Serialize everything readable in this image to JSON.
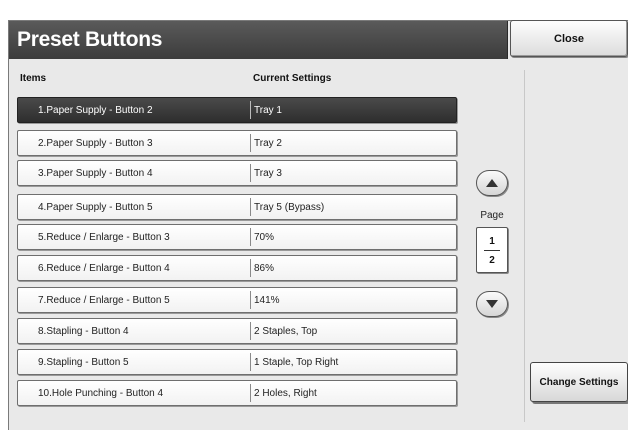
{
  "window": {
    "title": "Preset Buttons",
    "close_label": "Close"
  },
  "columns": {
    "items": "Items",
    "current_settings": "Current Settings"
  },
  "rows": [
    {
      "item": "1.Paper Supply - Button 2",
      "setting": "Tray 1",
      "selected": true
    },
    {
      "item": "2.Paper Supply - Button 3",
      "setting": "Tray 2",
      "selected": false
    },
    {
      "item": "3.Paper Supply - Button 4",
      "setting": "Tray 3",
      "selected": false
    },
    {
      "item": "4.Paper Supply - Button 5",
      "setting": "Tray 5 (Bypass)",
      "selected": false
    },
    {
      "item": "5.Reduce / Enlarge - Button 3",
      "setting": "70%",
      "selected": false
    },
    {
      "item": "6.Reduce / Enlarge - Button 4",
      "setting": "86%",
      "selected": false
    },
    {
      "item": "7.Reduce / Enlarge - Button 5",
      "setting": "141%",
      "selected": false
    },
    {
      "item": "8.Stapling - Button 4",
      "setting": "2 Staples, Top",
      "selected": false
    },
    {
      "item": "9.Stapling - Button 5",
      "setting": "1 Staple, Top Right",
      "selected": false
    },
    {
      "item": "10.Hole Punching - Button 4",
      "setting": "2 Holes, Right",
      "selected": false
    }
  ],
  "pagination": {
    "label": "Page",
    "current": "1",
    "total": "2",
    "up_icon": "triangle-up-icon",
    "down_icon": "triangle-down-icon"
  },
  "actions": {
    "change_settings_label": "Change Settings"
  }
}
